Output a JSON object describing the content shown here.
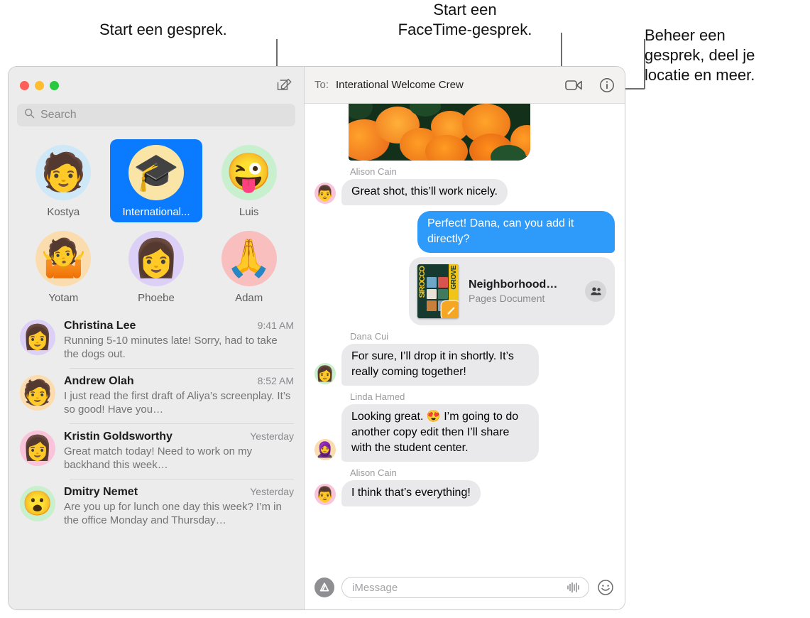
{
  "callouts": [
    {
      "id": "compose",
      "text": "Start een gesprek."
    },
    {
      "id": "facetime",
      "text": "Start een\nFaceTime-gesprek."
    },
    {
      "id": "info",
      "text": "Beheer een\ngesprek, deel je\nlocatie en meer."
    }
  ],
  "colors": {
    "accent_blue": "#0a7bff",
    "bubble_out": "#2e9bfa",
    "bubble_in": "#e9e9eb",
    "sidebar_bg": "#ececec",
    "header_bg": "#f4f2f0"
  },
  "titlebar": {
    "close_label": "close",
    "minimize_label": "minimize",
    "zoom_label": "zoom",
    "compose_icon": "compose-icon"
  },
  "search": {
    "icon": "search-icon",
    "placeholder": "Search"
  },
  "pinned": [
    {
      "name": "Kostya",
      "label": "Kostya",
      "emoji": "🧑",
      "bg": "#cfe8f7",
      "selected": false
    },
    {
      "name": "International",
      "label": "International...",
      "emoji": "🎓",
      "bg": "#fbe5a6",
      "selected": true
    },
    {
      "name": "Luis",
      "label": "Luis",
      "emoji": "😜",
      "bg": "#c9f0ce",
      "selected": false
    },
    {
      "name": "Yotam",
      "label": "Yotam",
      "emoji": "🤷",
      "bg": "#fbdcae",
      "selected": false
    },
    {
      "name": "Phoebe",
      "label": "Phoebe",
      "emoji": "👩",
      "bg": "#ddd0f7",
      "selected": false
    },
    {
      "name": "Adam",
      "label": "Adam",
      "emoji": "🙏",
      "bg": "#f9bfbe",
      "selected": false
    }
  ],
  "conversations": [
    {
      "name": "Christina Lee",
      "time": "9:41 AM",
      "preview": "Running 5-10 minutes late! Sorry, had to take the dogs out.",
      "emoji": "👩",
      "bg": "#ddd0f7"
    },
    {
      "name": "Andrew Olah",
      "time": "8:52 AM",
      "preview": "I just read the first draft of Aliya’s screenplay. It’s so good! Have you…",
      "emoji": "🧑",
      "bg": "#fbdcae"
    },
    {
      "name": "Kristin Goldsworthy",
      "time": "Yesterday",
      "preview": "Great match today! Need to work on my backhand this week…",
      "emoji": "👩",
      "bg": "#f9c3da"
    },
    {
      "name": "Dmitry Nemet",
      "time": "Yesterday",
      "preview": "Are you up for lunch one day this week? I’m in the office Monday and Thursday…",
      "emoji": "😮",
      "bg": "#c9f0ce"
    }
  ],
  "thread": {
    "to_label": "To:",
    "to_value": "Interational Welcome Crew",
    "facetime_icon": "video-camera-icon",
    "info_icon": "info-circle-icon",
    "photo_alt": "orange-flowers-photo",
    "messages": [
      {
        "type": "text",
        "direction": "in",
        "sender": "Alison Cain",
        "text": "Great shot, this’ll work nicely.",
        "emoji": "👨",
        "bg": "#f9c3da"
      },
      {
        "type": "text",
        "direction": "out",
        "sender": "",
        "text": "Perfect! Dana, can you add it directly?"
      },
      {
        "type": "attachment",
        "direction": "out",
        "title": "Neighborhood…",
        "subtitle": "Pages Document",
        "thumb_text_right": "GROVE",
        "thumb_text_left": "SIROCCO",
        "share_icon": "people-icon",
        "badge_icon": "pages-icon"
      },
      {
        "type": "text",
        "direction": "in",
        "sender": "Dana Cui",
        "text": "For sure, I’ll drop it in shortly. It’s really coming together!",
        "emoji": "👩",
        "bg": "#c9f0ce"
      },
      {
        "type": "text",
        "direction": "in",
        "sender": "Linda Hamed",
        "text": "Looking great. 😍 I’m going to do another copy edit then I’ll share with the student center.",
        "emoji": "🧕",
        "bg": "#fbdcae"
      },
      {
        "type": "text",
        "direction": "in",
        "sender": "Alison Cain",
        "text": "I think that’s everything!",
        "emoji": "👨",
        "bg": "#f9c3da"
      }
    ]
  },
  "input_bar": {
    "apps_icon": "app-store-icon",
    "placeholder": "iMessage",
    "audio_icon": "audio-waveform-icon",
    "emoji_icon": "smiley-icon"
  }
}
